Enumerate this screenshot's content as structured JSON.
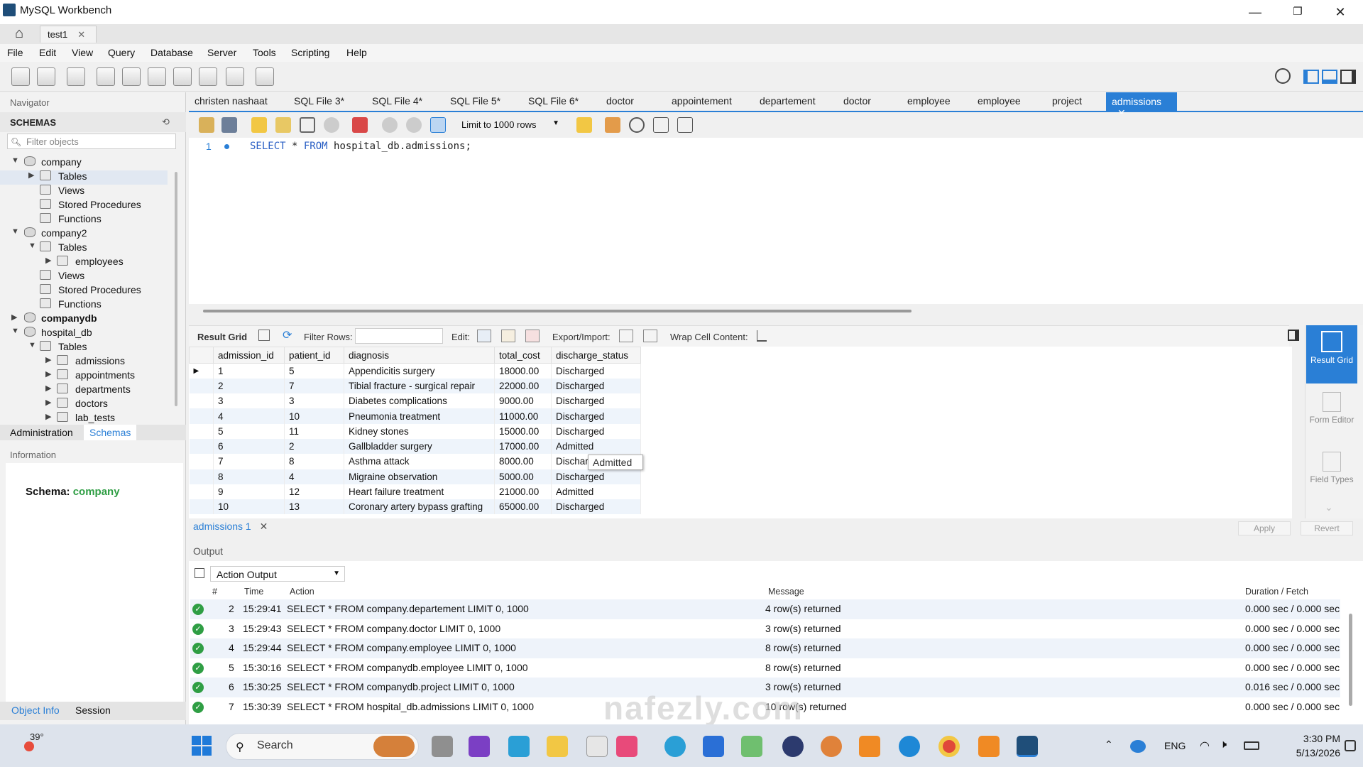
{
  "window": {
    "title": "MySQL Workbench"
  },
  "doc_tabs": [
    {
      "label": "test1"
    }
  ],
  "menu": [
    "File",
    "Edit",
    "View",
    "Query",
    "Database",
    "Server",
    "Tools",
    "Scripting",
    "Help"
  ],
  "navigator": {
    "header": "Navigator",
    "schemas_label": "SCHEMAS",
    "filter_placeholder": "Filter objects",
    "tree": [
      {
        "label": "company",
        "bold": false
      },
      {
        "label": "Tables"
      },
      {
        "label": "Views"
      },
      {
        "label": "Stored Procedures"
      },
      {
        "label": "Functions"
      },
      {
        "label": "company2"
      },
      {
        "label": "Tables"
      },
      {
        "label": "employees"
      },
      {
        "label": "Views"
      },
      {
        "label": "Stored Procedures"
      },
      {
        "label": "Functions"
      },
      {
        "label": "companydb",
        "bold": true
      },
      {
        "label": "hospital_db"
      },
      {
        "label": "Tables"
      },
      {
        "label": "admissions"
      },
      {
        "label": "appointments"
      },
      {
        "label": "departments"
      },
      {
        "label": "doctors"
      },
      {
        "label": "lab_tests"
      }
    ],
    "bottom_tabs": [
      "Administration",
      "Schemas"
    ],
    "info_header": "Information",
    "schema_info_label": "Schema:",
    "schema_info_value": "company",
    "obj_tabs": [
      "Object Info",
      "Session"
    ]
  },
  "query_tabs": [
    "christen nashaat",
    "SQL File 3*",
    "SQL File 4*",
    "SQL File 5*",
    "SQL File 6*",
    "doctor",
    "appointement",
    "departement",
    "doctor",
    "employee",
    "employee",
    "project"
  ],
  "active_query_tab": "admissions",
  "sql_toolbar": {
    "limit": "Limit to 1000 rows"
  },
  "editor": {
    "line_number": "1",
    "sql_keyword1": "SELECT",
    "sql_mid": " * ",
    "sql_keyword2": "FROM",
    "sql_rest": " hospital_db.admissions;"
  },
  "result_toolbar": {
    "result_grid": "Result Grid",
    "filter_rows": "Filter Rows:",
    "edit": "Edit:",
    "export_import": "Export/Import:",
    "wrap": "Wrap Cell Content:"
  },
  "grid": {
    "columns": [
      "admission_id",
      "patient_id",
      "diagnosis",
      "total_cost",
      "discharge_status"
    ],
    "rows": [
      [
        "1",
        "5",
        "Appendicitis surgery",
        "18000.00",
        "Discharged"
      ],
      [
        "2",
        "7",
        "Tibial fracture - surgical repair",
        "22000.00",
        "Discharged"
      ],
      [
        "3",
        "3",
        "Diabetes complications",
        "9000.00",
        "Discharged"
      ],
      [
        "4",
        "10",
        "Pneumonia treatment",
        "11000.00",
        "Discharged"
      ],
      [
        "5",
        "11",
        "Kidney stones",
        "15000.00",
        "Discharged"
      ],
      [
        "6",
        "2",
        "Gallbladder surgery",
        "17000.00",
        "Admitted"
      ],
      [
        "7",
        "8",
        "Asthma attack",
        "8000.00",
        "Discharg"
      ],
      [
        "8",
        "4",
        "Migraine observation",
        "5000.00",
        "Discharged"
      ],
      [
        "9",
        "12",
        "Heart failure treatment",
        "21000.00",
        "Admitted"
      ],
      [
        "10",
        "13",
        "Coronary artery bypass grafting",
        "65000.00",
        "Discharged"
      ]
    ],
    "tooltip": "Admitted"
  },
  "side_panel": {
    "result_grid": "Result Grid",
    "form_editor": "Form Editor",
    "field_types": "Field Types"
  },
  "result_tab": "admissions 1",
  "buttons": {
    "apply": "Apply",
    "revert": "Revert"
  },
  "output": {
    "header": "Output",
    "selector": "Action Output",
    "columns": {
      "num": "#",
      "time": "Time",
      "action": "Action",
      "message": "Message",
      "duration": "Duration / Fetch"
    },
    "rows": [
      {
        "num": "2",
        "time": "15:29:41",
        "action": "SELECT * FROM company.departement LIMIT 0, 1000",
        "message": "4 row(s) returned",
        "duration": "0.000 sec / 0.000 sec"
      },
      {
        "num": "3",
        "time": "15:29:43",
        "action": "SELECT * FROM company.doctor LIMIT 0, 1000",
        "message": "3 row(s) returned",
        "duration": "0.000 sec / 0.000 sec"
      },
      {
        "num": "4",
        "time": "15:29:44",
        "action": "SELECT * FROM company.employee LIMIT 0, 1000",
        "message": "8 row(s) returned",
        "duration": "0.000 sec / 0.000 sec"
      },
      {
        "num": "5",
        "time": "15:30:16",
        "action": "SELECT * FROM companydb.employee LIMIT 0, 1000",
        "message": "8 row(s) returned",
        "duration": "0.000 sec / 0.000 sec"
      },
      {
        "num": "6",
        "time": "15:30:25",
        "action": "SELECT * FROM companydb.project LIMIT 0, 1000",
        "message": "3 row(s) returned",
        "duration": "0.016 sec / 0.000 sec"
      },
      {
        "num": "7",
        "time": "15:30:39",
        "action": "SELECT * FROM hospital_db.admissions LIMIT 0, 1000",
        "message": "10 row(s) returned",
        "duration": "0.000 sec / 0.000 sec"
      }
    ]
  },
  "taskbar": {
    "weather": "39°",
    "search": "Search",
    "lang": "ENG",
    "time": "3:30 PM",
    "date": "5/13/2026"
  },
  "watermark": "nafezly.com",
  "colors": {
    "accent": "#2a7fd6",
    "schema_green": "#2f9e44"
  }
}
